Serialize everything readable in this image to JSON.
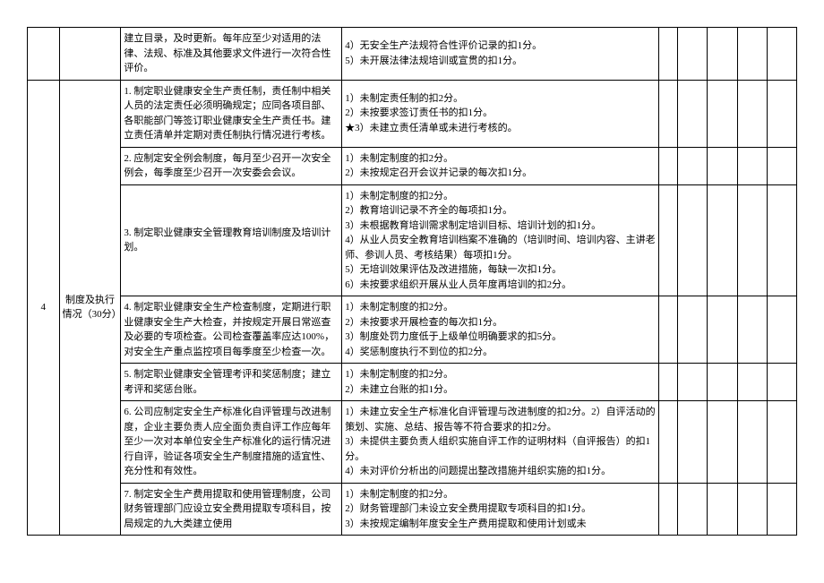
{
  "row_prev": {
    "c2": "建立目录，及时更新。每年应至少对适用的法律、法规、标准及其他要求文件进行一次符合性评价。",
    "c3": "4）无安全生产法规符合性评价记录的扣1分。\n5）未开展法律法规培训或宣贯的扣1分。"
  },
  "section": {
    "num": "4",
    "title": "制度及执行情况（30分）"
  },
  "rows": [
    {
      "c2": "1. 制定职业健康安全生产责任制，责任制中相关人员的法定责任必须明确规定；应同各项目部、各职能部门等签订职业健康安全生产责任书。建立责任清单并定期对责任制执行情况进行考核。",
      "c3": "1）未制定责任制的扣2分。\n2）未按要求签订责任书的扣1分。\n★3）未建立责任清单或未进行考核的。"
    },
    {
      "c2": "2. 应制定安全例会制度，每月至少召开一次安全例会，每季度至少召开一次安委会会议。",
      "c3": "1）未制定制度的扣2分。\n2）未按规定召开会议并记录的每次扣1分。"
    },
    {
      "c2": "3. 制定职业健康安全管理教育培训制度及培训计划。",
      "c3": "1）未制定制度的扣2分。\n2）教育培训记录不齐全的每项扣1分。\n3）未根据教育培训需求制定培训目标、培训计划的扣1分。\n4）从业人员安全教育培训档案不准确的（培训时间、培训内容、主讲老师、参训人员、考核结果）每项扣1分。\n5）无培训效果评估及改进措施，每缺一次扣1分。\n6）未按要求组织开展从业人员年度再培训的扣2分。"
    },
    {
      "c2": "4. 制定职业健康安全生产检查制度，定期进行职业健康安全生产大检查，并按规定开展日常巡查及必要的专项检查。公司检查覆盖率应达100%，对安全生产重点监控项目每季度至少检查一次。",
      "c3": "1）未制定制度的扣2分。\n2）未按要求开展检查的每次扣1分。\n3）制度处罚力度低于上级单位明确要求的扣5分。\n4）奖惩制度执行不到位的扣2分。"
    },
    {
      "c2": "5. 制定职业健康安全管理考评和奖惩制度；建立考评和奖惩台账。",
      "c3": "1）未制定制度的扣2分。\n2）未建立台账的扣1分。"
    },
    {
      "c2": "6. 公司应制定安全生产标准化自评管理与改进制度，企业主要负责人应全面负责自评工作应每年至少一次对本单位安全生产标准化的运行情况进行自评，验证各项安全生产制度措施的适宜性、充分性和有效性。",
      "c3": "1）未建立安全生产标准化自评管理与改进制度的扣2分。2）自评活动的策划、实施、总结、报告等不符合要求的扣2分。\n3）未提供主要负责人组织实施自评工作的证明材料（自评报告）的扣1分。\n4）未对评价分析出的问题提出整改措施并组织实施的扣1分。"
    },
    {
      "c2": "7. 制定安全生产费用提取和使用管理制度，公司财务管理部门应设立安全费用提取专项科目，按局规定的九大类建立使用",
      "c3": "1）未制定制度的扣2分。\n2）财务管理部门未设立安全费用提取专项科目的扣1分。\n3）未按规定编制年度安全生产费用提取和使用计划或未"
    }
  ]
}
